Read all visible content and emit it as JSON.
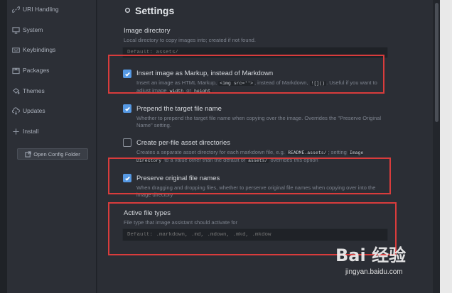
{
  "sidebar": {
    "items": [
      {
        "label": "URI Handling",
        "icon": "link-icon"
      },
      {
        "label": "System",
        "icon": "monitor-icon"
      },
      {
        "label": "Keybindings",
        "icon": "keyboard-icon"
      },
      {
        "label": "Packages",
        "icon": "package-icon"
      },
      {
        "label": "Themes",
        "icon": "paintcan-icon"
      },
      {
        "label": "Updates",
        "icon": "cloud-download-icon"
      },
      {
        "label": "Install",
        "icon": "plus-icon"
      }
    ],
    "config_button": "Open Config Folder"
  },
  "header": {
    "title": "Settings"
  },
  "settings": {
    "image_directory": {
      "label": "Image directory",
      "description": "Local directory to copy images into; created if not found.",
      "placeholder": "Default: assets/"
    },
    "insert_markup": {
      "checked": true,
      "label": "Insert image as Markup, instead of Markdown",
      "desc_1": "Insert an image as HTML Markup,",
      "code_1": "<img src=''>",
      "desc_2": ", instead of Markdown,",
      "code_2": "![]()",
      "desc_3": ". Useful if you want to adjust image",
      "code_3": "width",
      "desc_4": "or",
      "code_4": "height"
    },
    "prepend_target": {
      "checked": true,
      "label": "Prepend the target file name",
      "description": "Whether to prepend the target file name when copying over the image. Overrides the \"Preserve Original Name\" setting."
    },
    "per_file_dirs": {
      "checked": false,
      "label": "Create per-file asset directories",
      "desc_1": "Creates a separate asset directory for each markdown file, e.g.",
      "code_1": "README.assets/",
      "desc_2": "; setting",
      "code_2": "Image Directory",
      "desc_3": "to a value other than the default of",
      "code_3": "assets/",
      "desc_4": "overrides this option"
    },
    "preserve_names": {
      "checked": true,
      "label": "Preserve original file names",
      "description": "When dragging and dropping files, whether to perserve original file names when copying over into the image directory"
    },
    "active_types": {
      "label": "Active file types",
      "description": "File type that image assistant should activate for",
      "placeholder": "Default: .markdown, .md, .mdown, .mkd, .mkdow"
    }
  },
  "watermark": {
    "logo": "Bai 经验",
    "url": "jingyan.baidu.com"
  },
  "colors": {
    "accent": "#5699e4",
    "highlight": "#d93c3c",
    "background": "#2b2e35"
  }
}
